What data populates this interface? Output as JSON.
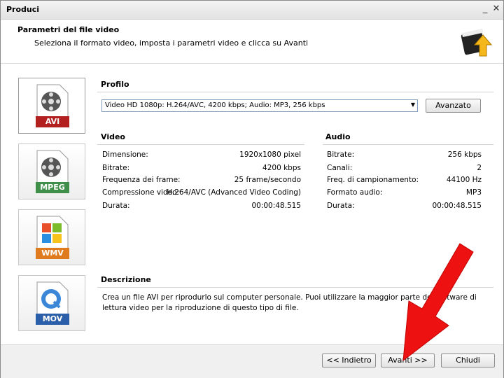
{
  "window": {
    "title": "Produci"
  },
  "header": {
    "title": "Parametri del file video",
    "subtitle": "Seleziona il formato video, imposta i parametri video e clicca su Avanti"
  },
  "formats": [
    {
      "label": "AVI",
      "color": "#b22020"
    },
    {
      "label": "MPEG",
      "color": "#3f8f4a"
    },
    {
      "label": "WMV",
      "color": "#e07a1f"
    },
    {
      "label": "MOV",
      "color": "#2c5faa"
    }
  ],
  "profile": {
    "heading": "Profilo",
    "selected": "Video HD 1080p: H.264/AVC, 4200 kbps; Audio: MP3, 256 kbps",
    "advanced_label": "Avanzato"
  },
  "video": {
    "heading": "Video",
    "rows": [
      {
        "label": "Dimensione:",
        "value": "1920x1080 pixel"
      },
      {
        "label": "Bitrate:",
        "value": "4200 kbps"
      },
      {
        "label": "Frequenza dei frame:",
        "value": "25 frame/secondo"
      },
      {
        "label": "Compressione video:",
        "value": "H.264/AVC (Advanced Video Coding)"
      },
      {
        "label": "Durata:",
        "value": "00:00:48.515"
      }
    ]
  },
  "audio": {
    "heading": "Audio",
    "rows": [
      {
        "label": "Bitrate:",
        "value": "256 kbps"
      },
      {
        "label": "Canali:",
        "value": "2"
      },
      {
        "label": "Freq. di campionamento:",
        "value": "44100 Hz"
      },
      {
        "label": "Formato audio:",
        "value": "MP3"
      },
      {
        "label": "Durata:",
        "value": "00:00:48.515"
      }
    ]
  },
  "description": {
    "heading": "Descrizione",
    "text": "Crea un file AVI per riprodurlo sul computer personale. Puoi utilizzare la maggior parte dei software di lettura video per la riproduzione di questo tipo di file."
  },
  "footer": {
    "back_label": "<< Indietro",
    "next_label": "Avanti >>",
    "close_label": "Chiudi"
  },
  "colors": {
    "arrow": "#ee1111",
    "accent_border": "#7f9db9"
  }
}
